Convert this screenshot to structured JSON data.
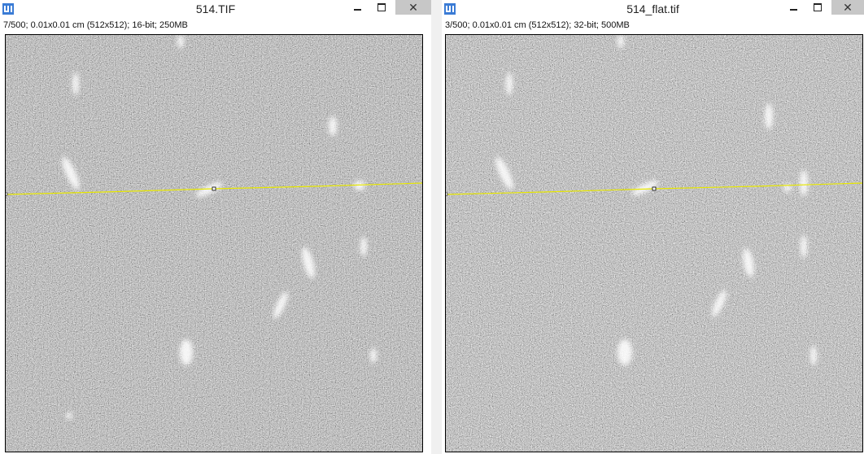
{
  "windows": [
    {
      "title": "514.TIF",
      "info": "7/500; 0.01x0.01 cm (512x512); 16-bit; 250MB",
      "icon": "imagej-icon",
      "controls": {
        "minimize": "minimize",
        "maximize": "maximize",
        "close": "close"
      }
    },
    {
      "title": "514_flat.tif",
      "info": "3/500; 0.01x0.01 cm (512x512); 32-bit; 500MB",
      "icon": "imagej-icon",
      "controls": {
        "minimize": "minimize",
        "maximize": "maximize",
        "close": "close"
      }
    }
  ],
  "colors": {
    "selection_line": "#e8e800",
    "close_button_bg": "#c7c7c7",
    "image_bg": "#2b2b2b"
  }
}
